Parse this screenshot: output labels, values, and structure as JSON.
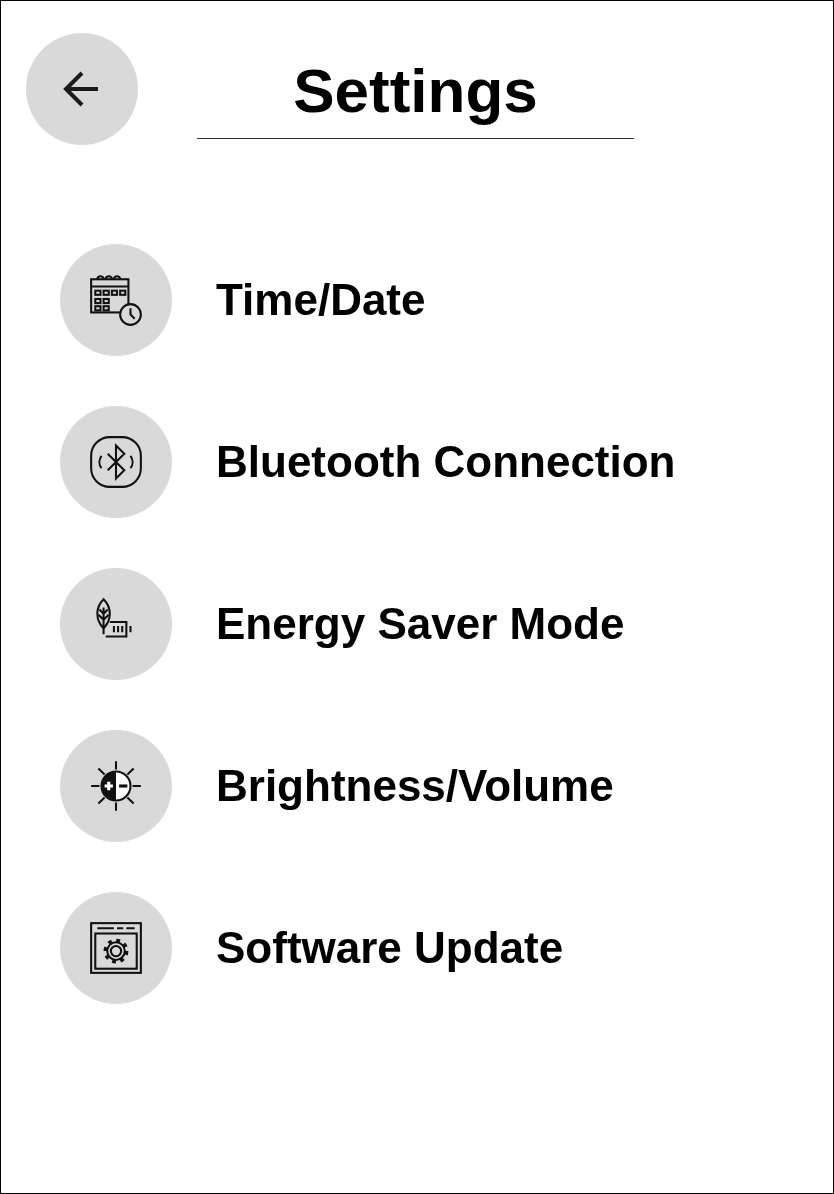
{
  "header": {
    "title": "Settings"
  },
  "items": [
    {
      "label": "Time/Date",
      "kind": "calendar"
    },
    {
      "label": "Bluetooth Connection",
      "kind": "bluetooth"
    },
    {
      "label": "Energy Saver Mode",
      "kind": "leaf"
    },
    {
      "label": "Brightness/Volume",
      "kind": "brightness"
    },
    {
      "label": "Software Update",
      "kind": "gear"
    }
  ]
}
